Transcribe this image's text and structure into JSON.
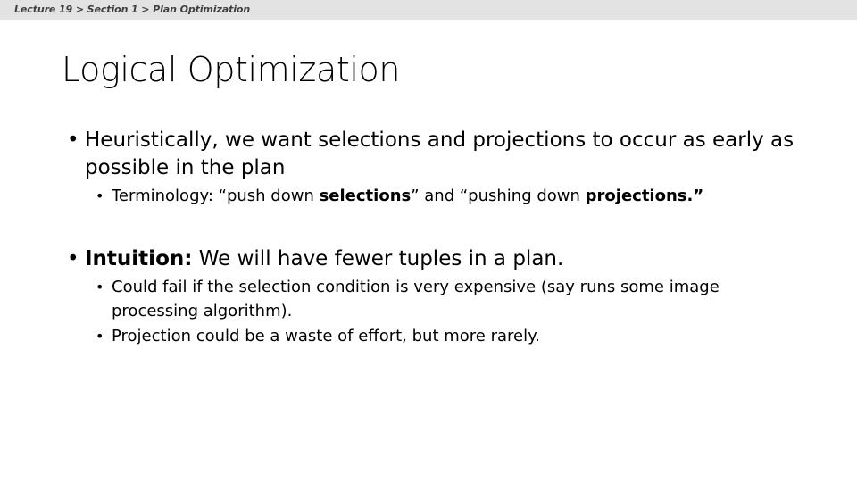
{
  "header": {
    "breadcrumb": "Lecture 19 > Section 1 > Plan Optimization",
    "band_color": "#e3e3e3",
    "text_color": "#3f3f3f"
  },
  "slide": {
    "title": "Logical Optimization",
    "background_color": "#ffffff",
    "text_color": "#000000",
    "bullet_marker": "•",
    "content": {
      "bullet1": {
        "text_before_bold": "Heuristically, we want selections and projections to occur as early as possible in the plan"
      },
      "bullet1_sub1": {
        "part1": "Terminology: “push down ",
        "bold1": "selections",
        "part2": "” and “pushing down ",
        "bold2": "projections.”"
      },
      "bullet2": {
        "bold1": "Intuition:",
        "part1": " We will have fewer tuples in a plan."
      },
      "bullet2_sub1": {
        "text": "Could fail if the selection condition is very expensive (say runs some image processing algorithm)."
      },
      "bullet2_sub2": {
        "text": "Projection could be a waste of effort, but more rarely."
      }
    }
  }
}
